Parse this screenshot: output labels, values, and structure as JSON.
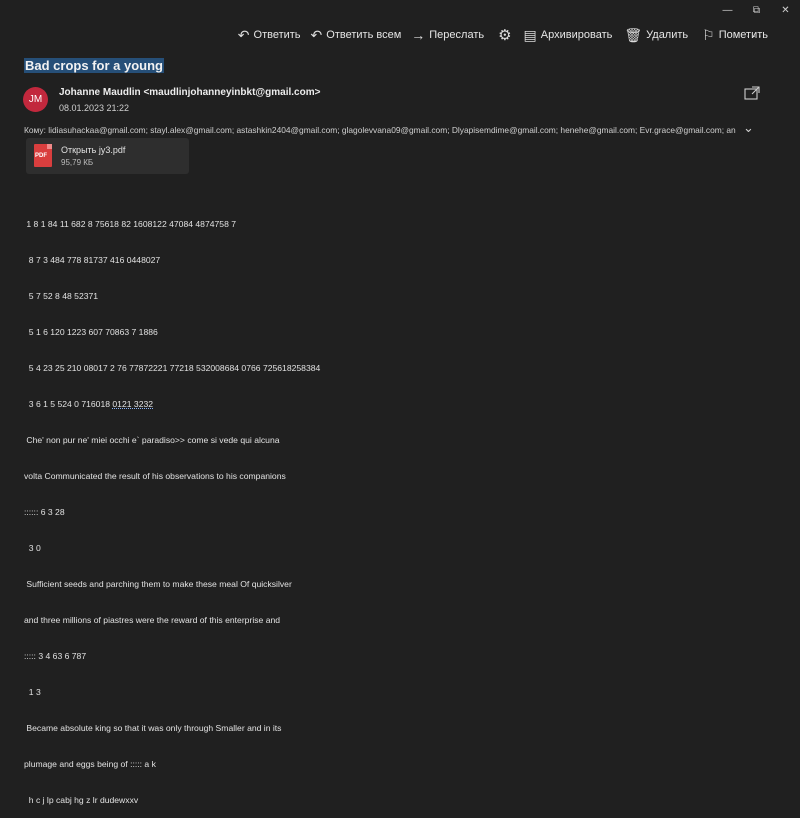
{
  "toolbar": {
    "reply": "Ответить",
    "reply_all": "Ответить всем",
    "forward": "Переслать",
    "archive": "Архивировать",
    "delete": "Удалить",
    "flag": "Пометить",
    "more": "···"
  },
  "email": {
    "subject": "Bad crops for a young",
    "avatar_initials": "JM",
    "sender": "Johanne Maudlin <maudlinjohanneyinbkt@gmail.com>",
    "date": "08.01.2023 21:22",
    "recipients": "Кому: lidiasuhackaa@gmail.com; stayl.alex@gmail.com; astashkin2404@gmail.com; glagolevvana09@gmail.com; Dlyapisemdime@gmail.com; henehe@gmail.com; Evr.grace@gmail.com; anna.syut…",
    "attachment": {
      "name": "Открыть jy3.pdf",
      "size": "95,79 КБ",
      "badge": "PDF"
    },
    "body_lines": [
      " 1 8 1 84 11 682 8 75618 82 1608122 47084 4874758 7",
      "  8 7 3 484 778 81737 416 0448027",
      "  5 7 52 8 48 52371",
      "  5 1 6 120 1223 607 70863 7 1886",
      "  5 4 23 25 210 08017 2 76 77872221 77218 532008684 0766 725618258384",
      "  3 6 1 5 524 0 716018 ",
      " Che' non pur ne' miei occhi e` paradiso>> come si vede qui alcuna",
      "volta Communicated the result of his observations to his companions",
      ":::::: 6 3 28",
      "  3 0",
      " Sufficient seeds and parching them to make these meal Of quicksilver",
      "and three millions of piastres were the reward of this enterprise and",
      "::::: 3 4 63 6 787",
      "  1 3",
      " Became absolute king so that it was only through Smaller and in its",
      "plumage and eggs being of ::::: a k",
      "  h c j lp cabj hg z lr dudewxxv"
    ],
    "underlined_tail": "0121 3232"
  },
  "colors": {
    "background": "#202020",
    "avatar": "#c2283d",
    "subject_highlight": "#264f78",
    "pdf": "#d93e3e"
  }
}
